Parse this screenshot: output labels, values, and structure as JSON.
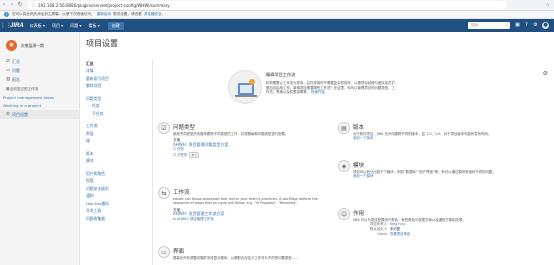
{
  "browser": {
    "url": "192.168.2.56:8080/plugins/servlet/project-config/WHWI/summary",
    "infobar_text": "您可以将此网页添加到主屏幕，以便下次快速访问。",
    "infobar_link1": "重新启动",
    "infobar_text2": "更改设置，请查看",
    "infobar_link2": "浏览器安全。"
  },
  "topnav": {
    "logo": "JIRA",
    "menus": [
      "仪表板 ▾",
      "项目 ▾",
      "问题 ▾",
      "看板 ▾"
    ],
    "create": "创建",
    "search_placeholder": "搜索"
  },
  "sidebar": {
    "project_name": "灾难监测一期",
    "items": [
      {
        "label": "汇总",
        "icon": "summary-icon"
      },
      {
        "label": "问题",
        "icon": "issues-icon"
      },
      {
        "label": "报告",
        "icon": "reports-icon"
      }
    ],
    "section1": "最近浏览过的工作流",
    "links": [
      "Project management Ideas",
      "Working in a project"
    ],
    "settings": "项目设置"
  },
  "main": {
    "title": "项目设置",
    "nav": {
      "head": "汇总",
      "group1": [
        "详情",
        "重新索引项目",
        "删除项目"
      ],
      "group2_head": "问题类型",
      "group2_sub": [
        "任务",
        "子任务"
      ],
      "group3": [
        "工作流",
        "界面",
        "域"
      ],
      "group4": [
        "版本",
        "模块"
      ],
      "group5": [
        "用户和角色",
        "权限",
        "问题安全级别",
        "通知",
        "HipChat通知",
        "开发工具",
        "问题收集器"
      ]
    },
    "intro": {
      "title": "编辑项目工作流",
      "desc": "机构需要以工作流为导向，且在采用时不需要复杂的操作，以便项目经理与团队成员们更加自由地工作。新增项目需要哪些工作流？在这里，你可以管理项目的问题类型、工作流、界面以及权限设置等。",
      "link": "快速开始"
    },
    "issue_types": {
      "title": "问题类型",
      "desc": "使用不同类型的问题来跟踪不同类型的工作，并按照每种问题类型进行配置。",
      "label": "方案",
      "scheme": "AHWH: 项目管理问题类型方案",
      "items": [
        "任务",
        "子任务"
      ],
      "tag": "默认"
    },
    "workflow": {
      "title": "工作流",
      "desc": "Issues can follow processes that mirror your team's practices. A workflow defines the sequence of steps that an issue will follow, e.g. \"In Progress\", \"Resolved\".",
      "label": "方案",
      "scheme": "AHWH: 项目管理工作流方案",
      "item": "AHWH: 项目管理工作流"
    },
    "screens": {
      "title": "界面",
      "desc": "屏幕允许你调整问题的字段显示顺序，以便配合自定义工作流与不同的问题类型……"
    },
    "versions": {
      "title": "版本",
      "desc": "对于软件项目，JIRA 允许你跟踪不同的版本，如 1.0、2.0。对于项目版本可能有发布时间。",
      "link": "添加一个版本"
    },
    "components": {
      "title": "模块",
      "desc": "项目可以划分出若干个模块，例如“数据库”“用户界面”等。你可以通过模块来组织不同的问题。",
      "link": "添加一个模块"
    },
    "roles": {
      "title": "作用",
      "desc": "JIRA 可以为项目配置用户角色，有些角色与权限方案以及通知方案相关联。",
      "rows": [
        {
          "k": "项目负责人",
          "v": "long.hua"
        },
        {
          "k": "默认经办人",
          "v": "未分配"
        },
        {
          "k": "Users",
          "v": "查看项目角色"
        }
      ]
    }
  }
}
